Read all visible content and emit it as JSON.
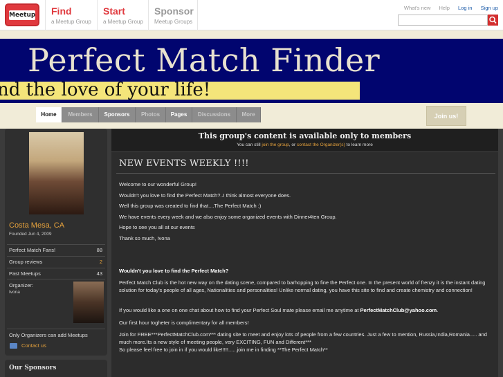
{
  "topnav": {
    "logo": "Meetup",
    "items": [
      {
        "title": "Find",
        "sub": "a Meetup Group"
      },
      {
        "title": "Start",
        "sub": "a Meetup Group"
      },
      {
        "title": "Sponsor",
        "sub": "Meetup Groups"
      }
    ],
    "links": {
      "whats_new": "What's new",
      "help": "Help",
      "login": "Log in",
      "signup": "Sign up"
    }
  },
  "banner": {
    "title": "Perfect Match Finder",
    "tagline": "nd the love of your life!"
  },
  "tabs": [
    "Home",
    "Members",
    "Sponsors",
    "Photos",
    "Pages",
    "Discussions",
    "More"
  ],
  "join_label": "Join us!",
  "sidebar": {
    "city": "Costa Mesa, CA",
    "founded": "Founded Jun 4, 2009",
    "stats": [
      {
        "label": "Perfect Match Fans!",
        "value": "88"
      },
      {
        "label": "Group reviews",
        "value": "2"
      },
      {
        "label": "Past Meetups",
        "value": "43"
      }
    ],
    "organizer_label": "Organizer:",
    "organizer_name": "Ivona",
    "only_organizers": "Only Organizers can add Meetups",
    "contact": "Contact us",
    "sponsors_title": "Our Sponsors"
  },
  "notice": {
    "title": "This group's content is available only to members",
    "sub_pre": "You can still ",
    "join_link": "join the group",
    "sub_mid": ", or ",
    "contact_link": "contact the Organizer(s)",
    "sub_post": " to learn more"
  },
  "content": {
    "headline": "NEW EVENTS WEEKLY !!!!",
    "paragraphs": [
      "Welcome to our wonderful Group!",
      "Wouldn't you love to find the Perfect Match?..I think almost everyone does.",
      "Well this group was created to find that....The Perfect Match :)",
      "We have events every week and we also enjoy some organized events with Dinner4ten Group.",
      "Hope to see you all at our events",
      "Thank so much, Ivona"
    ],
    "subhead": "Wouldn't you love to find the Perfect Match?",
    "p_club": "Perfect Match Club is the hot new way on the dating scene, compared to barhopping to fine the Perfect one. In the present world of frenzy it is the instant dating solution for today's people of all ages, Nationalities and personalities! Unlike normal dating, you have this site to find and create chemistry and connection!",
    "p_chat_pre": "If you would like a one on one chat about how to find your Perfect Soul mate please email me anytime at ",
    "p_chat_email": "PerfectMatchClub@yahoo.com",
    "p_chat_post": ".",
    "p_first": "Our first hour togheter is complimentary for all members!",
    "p_join": "Join for FREE***PerfectMatchClub.com*** dating site to meet and enjoy lots of people from a few countries. Just a few to mention, Russia,India,Romania..... and much more.Its a new style of meeting people, very EXCITING, FUN and Different***",
    "p_free": "So please feel free to join in if you would like!!!!!......join me in finding **The Perfect Match**"
  },
  "colors": {
    "find": "#e0393e",
    "start": "#e0393e",
    "sponsor": "#999999",
    "accent": "#e6a23c",
    "banner": "#01056f"
  }
}
